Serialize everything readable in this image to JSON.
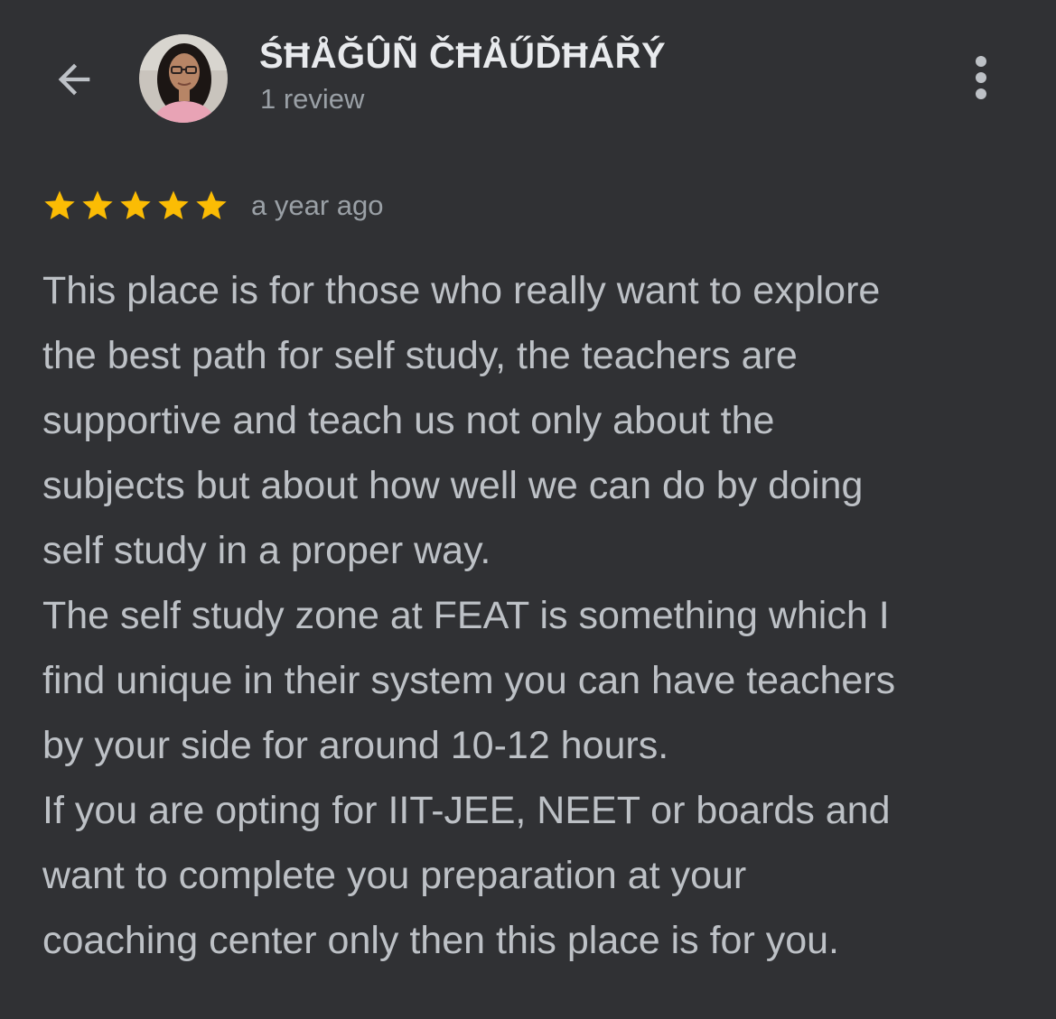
{
  "header": {
    "back_icon": "arrow-left-icon",
    "avatar_icon": "user-avatar",
    "reviewer_name": "ŚĦÅĞÛÑ ČĦÅŰĎĦÁŘÝ",
    "review_count": "1 review",
    "menu_icon": "more-vert-icon"
  },
  "review": {
    "rating": 5,
    "rating_max": 5,
    "star_color": "#fbbc04",
    "time_ago": "a year ago",
    "text": "This place is for those who really want to explore\nthe best path for self study, the teachers are\nsupportive and teach us not only about the\nsubjects but about how well we can do by doing\nself study in a proper way.\nThe self study zone at FEAT is something which I\nfind unique in their system you can have teachers\nby your side for around 10-12 hours.\nIf you are opting for IIT-JEE, NEET or boards and\nwant to complete you preparation at your\ncoaching center only then this place is for you."
  },
  "colors": {
    "background": "#303134",
    "primary_text": "#e8eaed",
    "secondary_text": "#9aa0a6",
    "body_text": "#bdc1c6"
  }
}
